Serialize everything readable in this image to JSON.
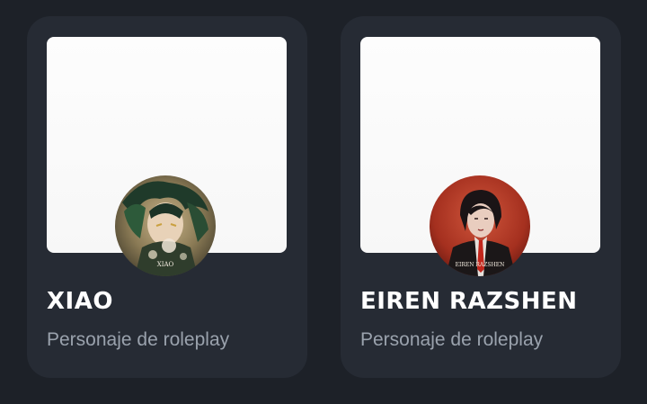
{
  "cards": [
    {
      "name": "XIAO",
      "subtitle": "Personaje de roleplay",
      "avatar_caption": "XIAO"
    },
    {
      "name": "EIREN RAZSHEN",
      "subtitle": "Personaje de roleplay",
      "avatar_caption": "EIREN RAZSHEN"
    }
  ],
  "colors": {
    "page_background": "#1d2128",
    "card_background": "#262b34",
    "title": "#ffffff",
    "subtitle": "#9aa2ad"
  }
}
